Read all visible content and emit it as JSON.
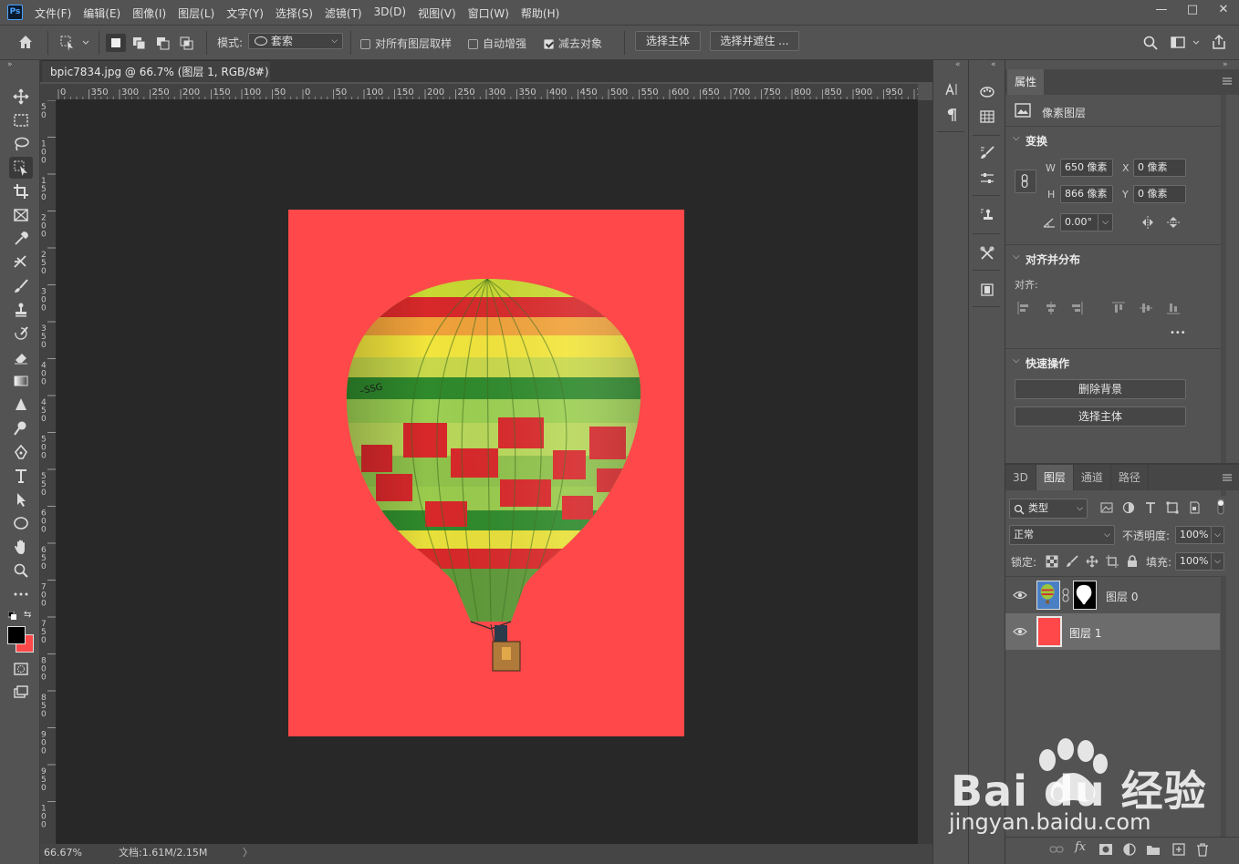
{
  "app": {
    "logo": "Ps"
  },
  "menu": [
    "文件(F)",
    "编辑(E)",
    "图像(I)",
    "图层(L)",
    "文字(Y)",
    "选择(S)",
    "滤镜(T)",
    "3D(D)",
    "视图(V)",
    "窗口(W)",
    "帮助(H)"
  ],
  "window_controls": {
    "minimize": "—",
    "maximize": "□",
    "close": "✕"
  },
  "options": {
    "mode_label": "模式:",
    "mode_value": "套索",
    "sample_all_layers": "对所有图层取样",
    "auto_enhance": "自动增强",
    "subtract_object": "减去对象",
    "select_subject": "选择主体",
    "select_and_mask": "选择并遮住 ...",
    "subtract_checked": true
  },
  "document": {
    "tab_title": "bpic7834.jpg @ 66.7% (图层 1, RGB/8#) *",
    "zoom": "66.67%",
    "doc_info": "文档:1.61M/2.15M",
    "canvas_color": "#fe4849"
  },
  "ruler": {
    "h_ticks": [
      "0",
      "350",
      "300",
      "250",
      "200",
      "150",
      "100",
      "50",
      "0",
      "50",
      "100",
      "150",
      "200",
      "250",
      "300",
      "350",
      "400",
      "450",
      "500",
      "550",
      "600",
      "650",
      "700",
      "750",
      "800",
      "850",
      "900",
      "950",
      "100"
    ],
    "v_ticks": [
      "5 0",
      "1 0 0",
      "1 5 0",
      "2 0 0",
      "2 5 0",
      "3 0 0",
      "3 5 0",
      "4 0 0",
      "4 5 0",
      "5 0 0",
      "5 5 0",
      "6 0 0",
      "6 5 0",
      "7 0 0",
      "7 5 0",
      "8 0 0",
      "8 5 0",
      "9 0 0",
      "9 5 0",
      "1 0 0"
    ]
  },
  "properties": {
    "tab": "属性",
    "layer_type": "像素图层",
    "transform_title": "变换",
    "w_label": "W",
    "w_value": "650 像素",
    "h_label": "H",
    "h_value": "866 像素",
    "x_label": "X",
    "x_value": "0 像素",
    "y_label": "Y",
    "y_value": "0 像素",
    "angle_value": "0.00°",
    "align_title": "对齐并分布",
    "align_label": "对齐:",
    "more": "•••",
    "quick_title": "快速操作",
    "remove_bg": "删除背景",
    "select_subject": "选择主体"
  },
  "layers_panel": {
    "tabs": [
      "3D",
      "图层",
      "通道",
      "路径"
    ],
    "active_tab": "图层",
    "filter_kind": "类型",
    "blend_mode": "正常",
    "opacity_label": "不透明度:",
    "opacity_value": "100%",
    "lock_label": "锁定:",
    "fill_label": "填充:",
    "fill_value": "100%",
    "layers": [
      {
        "name": "图层 0",
        "has_mask": true,
        "selected": false
      },
      {
        "name": "图层 1",
        "has_mask": false,
        "selected": true,
        "thumb_color": "#fe4849"
      }
    ]
  },
  "watermark": {
    "brand": "Bai du 经验",
    "url": "jingyan.baidu.com"
  }
}
